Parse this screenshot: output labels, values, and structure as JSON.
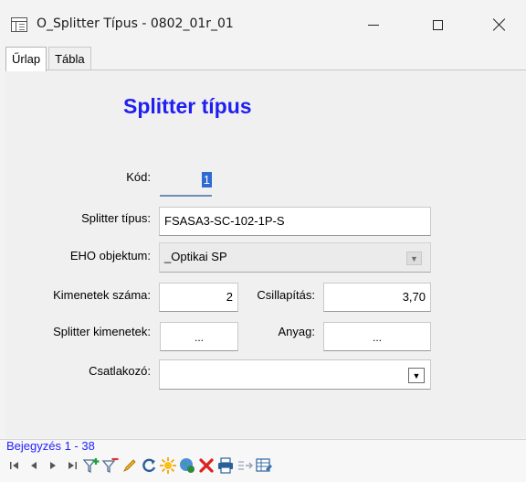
{
  "window": {
    "title": "O_Splitter Típus - 0802_01r_01",
    "icon": "datasheet-icon"
  },
  "tabs": [
    {
      "label": "Űrlap",
      "active": true
    },
    {
      "label": "Tábla",
      "active": false
    }
  ],
  "form": {
    "title": "Splitter típus",
    "fields": {
      "kod": {
        "label": "Kód:",
        "value": "1"
      },
      "splitter_tipus": {
        "label": "Splitter típus:",
        "value": "FSASA3-SC-102-1P-S"
      },
      "eho_objektum": {
        "label": "EHO objektum:",
        "value": "_Optikai SP"
      },
      "kimenetek_szama": {
        "label": "Kimenetek száma:",
        "value": "2"
      },
      "csillapitas": {
        "label": "Csillapítás:",
        "value": "3,70"
      },
      "splitter_kimenetek": {
        "label": "Splitter kimenetek:",
        "button": "..."
      },
      "anyag": {
        "label": "Anyag:",
        "button": "..."
      },
      "csatlakozo": {
        "label": "Csatlakozó:",
        "value": ""
      }
    }
  },
  "status": {
    "record": "Bejegyzés 1 - 38"
  },
  "toolbar": {
    "icons": [
      "first-record-icon",
      "previous-record-icon",
      "next-record-icon",
      "last-record-icon",
      "add-filter-icon",
      "remove-filter-icon",
      "edit-icon",
      "refresh-icon",
      "new-record-icon",
      "web-lookup-icon",
      "delete-icon",
      "print-icon",
      "export-icon",
      "table-view-icon"
    ]
  },
  "colors": {
    "title_blue": "#1f1ff2",
    "record_label_blue": "#2323ff",
    "selection_blue": "#2e6ad1"
  }
}
